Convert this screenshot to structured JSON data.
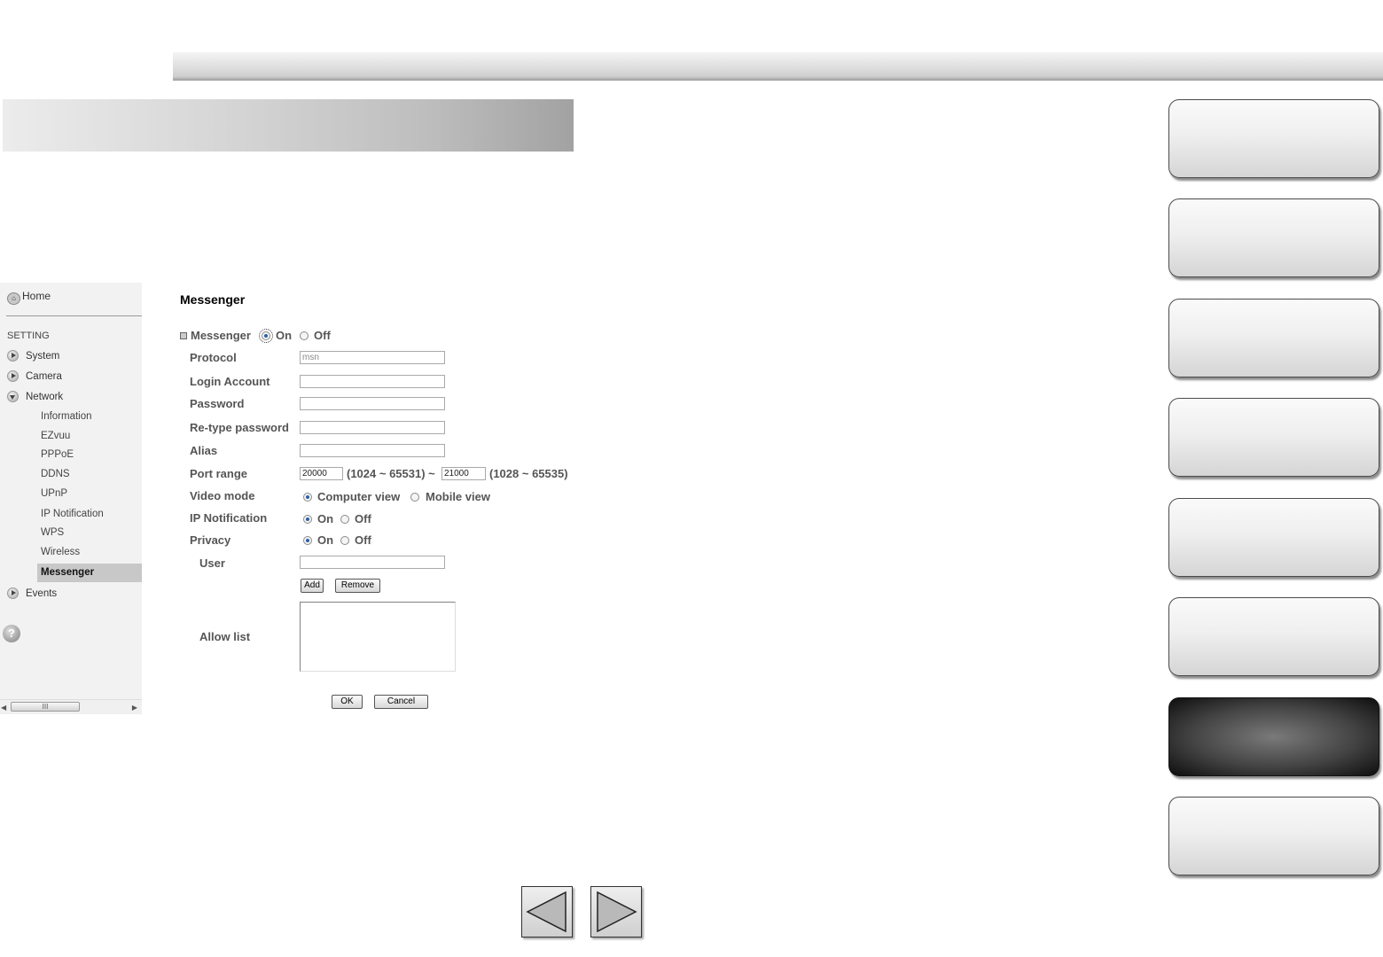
{
  "nav": {
    "home": "Home",
    "section": "SETTING",
    "items": [
      {
        "label": "System"
      },
      {
        "label": "Camera"
      },
      {
        "label": "Network"
      },
      {
        "label": "Events"
      }
    ],
    "network_sub": [
      {
        "label": "Information"
      },
      {
        "label": "EZvuu"
      },
      {
        "label": "PPPoE"
      },
      {
        "label": "DDNS"
      },
      {
        "label": "UPnP"
      },
      {
        "label": "IP Notification"
      },
      {
        "label": "WPS"
      },
      {
        "label": "Wireless"
      },
      {
        "label": "Messenger"
      }
    ],
    "selected": "Messenger",
    "help_glyph": "?",
    "scroll_grip": "III"
  },
  "form": {
    "title": "Messenger",
    "messenger_label": "Messenger",
    "on": "On",
    "off": "Off",
    "protocol_label": "Protocol",
    "protocol_value": "msn",
    "login_label": "Login Account",
    "login_value": "",
    "password_label": "Password",
    "password_value": "",
    "retype_label": "Re-type password",
    "retype_value": "",
    "alias_label": "Alias",
    "alias_value": "",
    "port_label": "Port range",
    "port_from": "20000",
    "port_from_range": "(1024 ~ 65531) ~",
    "port_to": "21000",
    "port_to_range": "(1028 ~ 65535)",
    "video_label": "Video mode",
    "computer_view": "Computer view",
    "mobile_view": "Mobile view",
    "ipnotif_label": "IP Notification",
    "privacy_label": "Privacy",
    "user_label": "User",
    "user_value": "",
    "add": "Add",
    "remove": "Remove",
    "allow_label": "Allow list",
    "ok": "OK",
    "cancel": "Cancel",
    "state": {
      "messenger": "On",
      "video_mode": "Computer view",
      "ip_notification": "On",
      "privacy": "On"
    }
  },
  "side_tabs": {
    "count": 8,
    "active_index": 7
  },
  "icons": {
    "prev": "left-triangle-arrow",
    "next": "right-triangle-arrow"
  }
}
